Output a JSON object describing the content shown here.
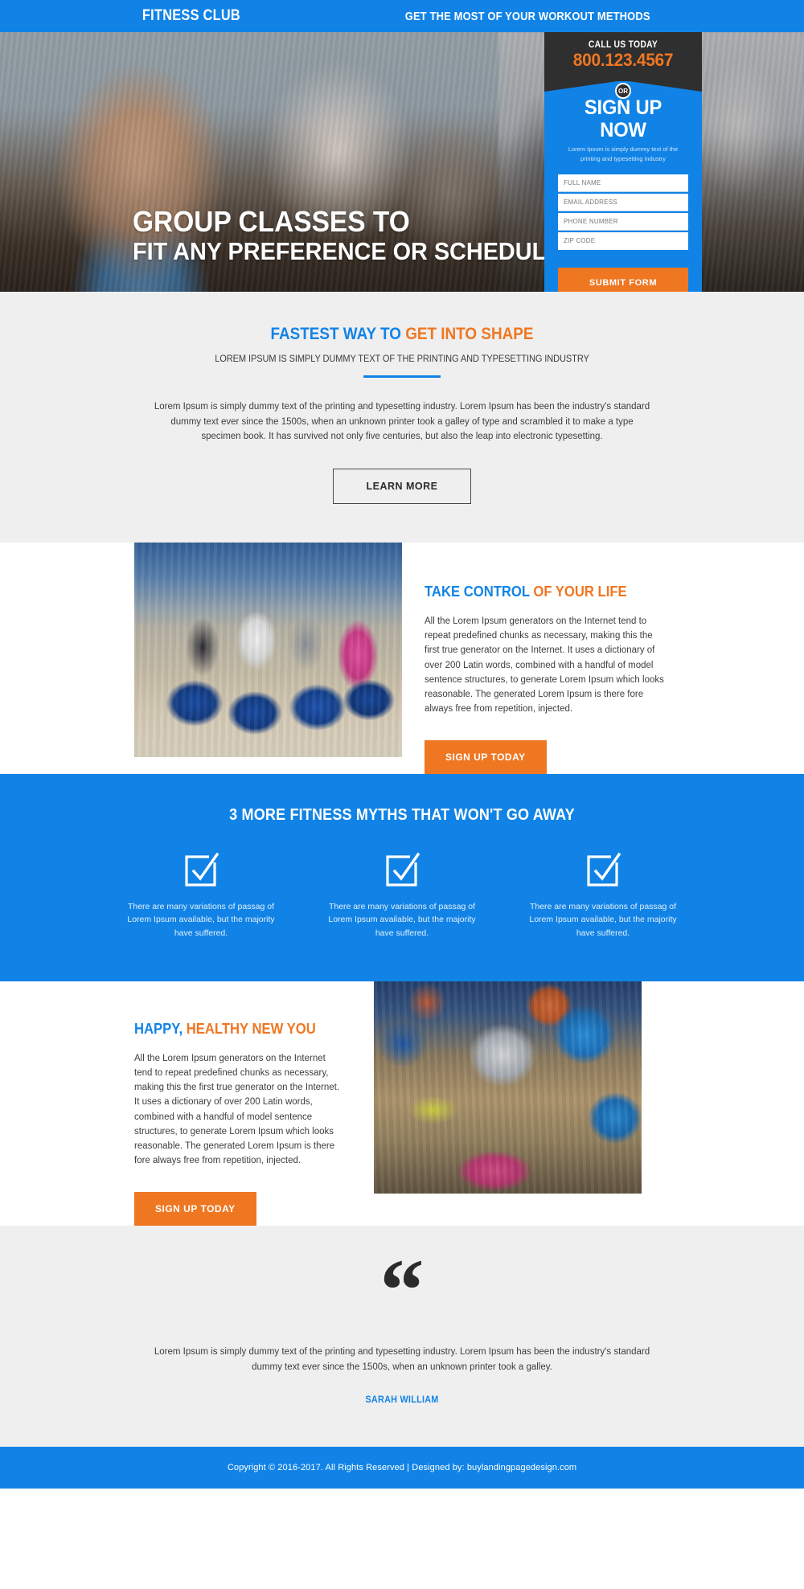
{
  "header": {
    "brand": "FITNESS CLUB",
    "tagline": "GET THE MOST OF YOUR WORKOUT METHODS"
  },
  "hero": {
    "headline_line1": "GROUP CLASSES TO",
    "headline_line2": "FIT ANY PREFERENCE OR SCHEDULE"
  },
  "signup_form": {
    "call_label": "CALL US TODAY",
    "phone": "800.123.4567",
    "or_badge": "OR",
    "title": "SIGN UP NOW",
    "subtitle": "Lorem Ipsum is simply dummy text of the printing and typesetting industry",
    "fields": [
      {
        "name": "full-name",
        "placeholder": "FULL NAME",
        "value": ""
      },
      {
        "name": "email-address",
        "placeholder": "EMAIL ADDRESS",
        "value": ""
      },
      {
        "name": "phone-number",
        "placeholder": "PHONE NUMBER",
        "value": ""
      },
      {
        "name": "zip-code",
        "placeholder": "ZIP CODE",
        "value": ""
      }
    ],
    "submit_label": "SUBMIT FORM"
  },
  "intro_section": {
    "title_blue": "FASTEST WAY TO",
    "title_orange": "GET INTO SHAPE",
    "subtitle": "LOREM IPSUM IS SIMPLY DUMMY TEXT OF THE PRINTING AND TYPESETTING INDUSTRY",
    "paragraph": "Lorem Ipsum is simply dummy text of the printing and typesetting industry. Lorem Ipsum has been the industry's standard dummy text ever since the 1500s, when an unknown printer took a galley of type and scrambled it to make a type specimen book. It has survived not only five centuries, but also the leap into electronic typesetting.",
    "button_label": "LEARN MORE"
  },
  "take_control_section": {
    "title_blue": "TAKE CONTROL",
    "title_orange": "OF YOUR LIFE",
    "paragraph": "All the Lorem Ipsum generators on the Internet tend to repeat predefined chunks as necessary, making this the first true generator on the Internet. It uses a dictionary of over 200 Latin words, combined with a handful of model sentence structures, to generate Lorem Ipsum which looks reasonable. The generated Lorem Ipsum is there fore always free from repetition, injected.",
    "button_label": "SIGN UP TODAY",
    "image_alt": "group-fitness-class-on-stability-balls"
  },
  "myths_section": {
    "title": "3 MORE FITNESS MYTHS THAT WON'T GO AWAY",
    "items": [
      {
        "icon": "checkbox-check-icon",
        "text": "There are many variations of passag of Lorem Ipsum available, but the majority have suffered."
      },
      {
        "icon": "checkbox-check-icon",
        "text": "There are many variations of passag of Lorem Ipsum available, but the majority have suffered."
      },
      {
        "icon": "checkbox-check-icon",
        "text": "There are many variations of passag of Lorem Ipsum available, but the majority have suffered."
      }
    ]
  },
  "happy_section": {
    "title_blue": "HAPPY,",
    "title_orange": "HEALTHY NEW YOU",
    "paragraph": "All the Lorem Ipsum generators on the Internet tend to repeat predefined chunks as necessary, making this the first true generator on the Internet. It uses a dictionary of over 200 Latin words, combined with a handful of model sentence structures, to generate Lorem Ipsum which looks reasonable. The generated Lorem Ipsum is there fore always free from repetition, injected.",
    "button_label": "SIGN UP TODAY",
    "image_alt": "pilates-class-with-exercise-balls"
  },
  "testimonial": {
    "quote_mark": "“",
    "text": "Lorem Ipsum is simply dummy text of the printing and typesetting industry. Lorem Ipsum has been the industry's standard dummy text ever since the 1500s, when an unknown printer took a galley.",
    "author": "SARAH WILLIAM"
  },
  "footer": {
    "text": "Copyright © 2016-2017. All Rights Reserved  |  Designed by: buylandingpagedesign.com"
  },
  "colors": {
    "brand_blue": "#1183e6",
    "accent_orange": "#ef7722",
    "dark_panel": "#2f2f2f",
    "light_gray": "#efefef"
  }
}
